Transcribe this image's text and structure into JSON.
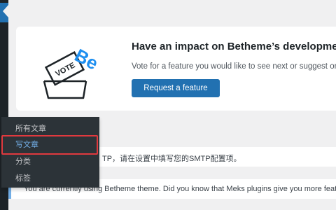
{
  "promo": {
    "title": "Have an impact on Betheme’s development",
    "description": "Vote for a feature you would like to see next or suggest one",
    "button_label": "Request a feature",
    "logo": {
      "ballot_text": "VOTE",
      "brand_text": "Be"
    }
  },
  "notices": {
    "smtp": "TP，请在设置中填写您的SMTP配置项。",
    "meks": "You are currently using Betheme theme. Did you know that Meks plugins give you more featu"
  },
  "submenu": {
    "items": [
      {
        "label": "所有文章"
      },
      {
        "label": "写文章"
      },
      {
        "label": "分类"
      },
      {
        "label": "标签"
      }
    ]
  },
  "colors": {
    "accent": "#2271b1",
    "highlight": "#e0393e",
    "brand_logo": "#1e8ff0"
  }
}
